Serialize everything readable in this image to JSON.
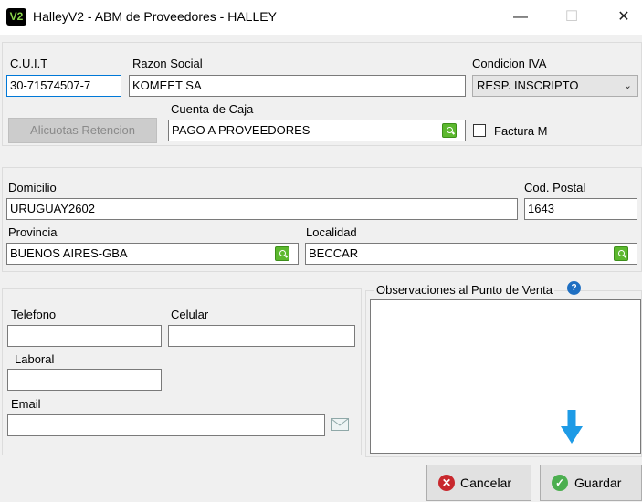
{
  "window": {
    "logo": "V2",
    "title": "HalleyV2 - ABM de Proveedores - HALLEY",
    "minimize": "—",
    "maximize": "☐",
    "close": "✕"
  },
  "proveedor": {
    "cuit_label": "C.U.I.T",
    "cuit_value": "30-71574507-7",
    "razon_label": "Razon Social",
    "razon_value": "KOMEET SA",
    "iva_label": "Condicion IVA",
    "iva_value": "RESP. INSCRIPTO",
    "alicuotas_button": "Alicuotas Retencion",
    "cuenta_label": "Cuenta de Caja",
    "cuenta_value": "PAGO A PROVEEDORES",
    "factura_m_label": "Factura M"
  },
  "direccion": {
    "domicilio_label": "Domicilio",
    "domicilio_value": "URUGUAY2602",
    "cp_label": "Cod. Postal",
    "cp_value": "1643",
    "provincia_label": "Provincia",
    "provincia_value": "BUENOS AIRES-GBA",
    "localidad_label": "Localidad",
    "localidad_value": "BECCAR"
  },
  "contacto": {
    "telefono_label": "Telefono",
    "telefono_value": "",
    "celular_label": "Celular",
    "celular_value": "",
    "laboral_label": "Laboral",
    "laboral_value": "",
    "email_label": "Email",
    "email_value": ""
  },
  "observaciones": {
    "label": "Observaciones al Punto de Venta",
    "help": "?",
    "value": ""
  },
  "actions": {
    "cancel_label": "Cancelar",
    "save_label": "Guardar"
  },
  "colors": {
    "accent": "#0078d7",
    "arrow": "#1e9be6",
    "search_green": "#5cb82e",
    "cancel_red": "#c8282d",
    "save_green": "#4caf50"
  }
}
